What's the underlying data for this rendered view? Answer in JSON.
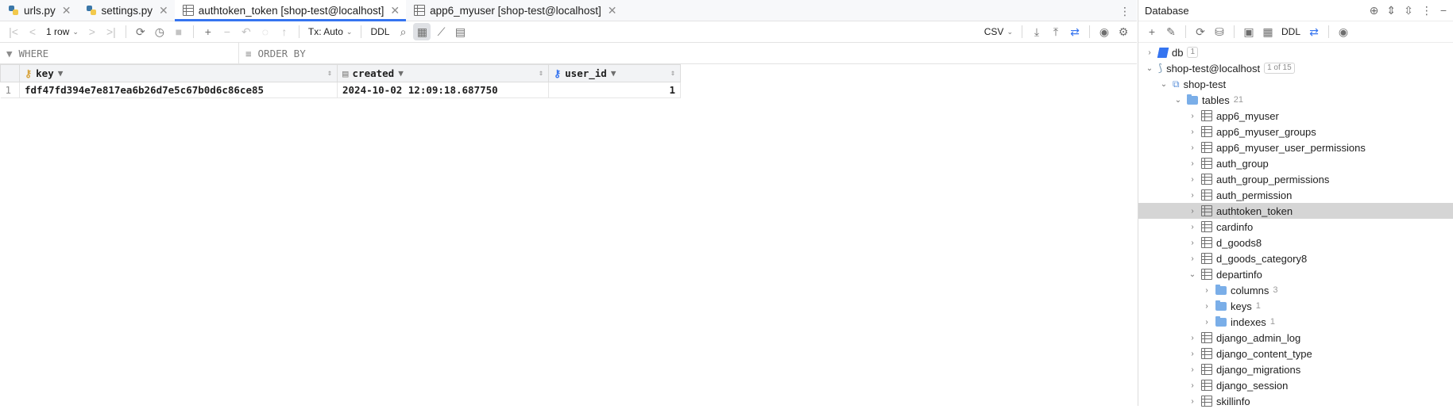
{
  "tabs": [
    {
      "label": "urls.py",
      "icon": "python-icon",
      "active": false
    },
    {
      "label": "settings.py",
      "icon": "python-icon",
      "active": false
    },
    {
      "label": "authtoken_token [shop-test@localhost]",
      "icon": "table-icon",
      "active": true
    },
    {
      "label": "app6_myuser [shop-test@localhost]",
      "icon": "table-icon",
      "active": false
    }
  ],
  "toolbar": {
    "rows": "1 row",
    "tx": "Tx: Auto",
    "ddl": "DDL",
    "export_format": "CSV"
  },
  "filter": {
    "where": "WHERE",
    "order_by": "ORDER BY"
  },
  "grid": {
    "columns": [
      "key",
      "created",
      "user_id"
    ],
    "rows": [
      {
        "n": "1",
        "key": "fdf47fd394e7e817ea6b26d7e5c67b0d6c86ce85",
        "created": "2024-10-02 12:09:18.687750",
        "user_id": "1"
      }
    ]
  },
  "panel": {
    "title": "Database",
    "ddl": "DDL"
  },
  "tree": {
    "db": {
      "label": "db",
      "badge": "1"
    },
    "conn": {
      "label": "shop-test@localhost",
      "badge": "1 of 15"
    },
    "schema": {
      "label": "shop-test"
    },
    "tables_folder": {
      "label": "tables",
      "count": "21"
    },
    "tables": [
      "app6_myuser",
      "app6_myuser_groups",
      "app6_myuser_user_permissions",
      "auth_group",
      "auth_group_permissions",
      "auth_permission",
      "authtoken_token",
      "cardinfo",
      "d_goods8",
      "d_goods_category8",
      "departinfo"
    ],
    "departinfo_children": [
      {
        "label": "columns",
        "count": "3"
      },
      {
        "label": "keys",
        "count": "1"
      },
      {
        "label": "indexes",
        "count": "1"
      }
    ],
    "tables_after": [
      "django_admin_log",
      "django_content_type",
      "django_migrations",
      "django_session",
      "skillinfo"
    ],
    "selected": "authtoken_token"
  }
}
